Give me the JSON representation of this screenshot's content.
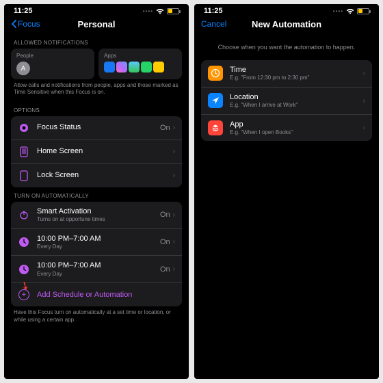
{
  "status": {
    "time": "11:25"
  },
  "left": {
    "back": "Focus",
    "title": "Personal",
    "allowed_header": "ALLOWED NOTIFICATIONS",
    "people_label": "People",
    "people_initial": "A",
    "apps_label": "Apps",
    "allowed_footer": "Allow calls and notifications from people, apps and those marked as Time Sensitive when this Focus is on.",
    "options_header": "OPTIONS",
    "options": [
      {
        "label": "Focus Status",
        "value": "On"
      },
      {
        "label": "Home Screen",
        "value": ""
      },
      {
        "label": "Lock Screen",
        "value": ""
      }
    ],
    "auto_header": "TURN ON AUTOMATICALLY",
    "auto": [
      {
        "label": "Smart Activation",
        "sub": "Turns on at opportune times",
        "value": "On"
      },
      {
        "label": "10:00 PM–7:00 AM",
        "sub": "Every Day",
        "value": "On"
      },
      {
        "label": "10:00 PM–7:00 AM",
        "sub": "Every Day",
        "value": "On"
      }
    ],
    "add_label": "Add Schedule or Automation",
    "auto_footer": "Have this Focus turn on automatically at a set time or location, or while using a certain app."
  },
  "right": {
    "cancel": "Cancel",
    "title": "New Automation",
    "prompt": "Choose when you want the automation to happen.",
    "triggers": [
      {
        "label": "Time",
        "sub": "E.g. \"From 12:30 pm to 2:30 pm\"",
        "color": "orange"
      },
      {
        "label": "Location",
        "sub": "E.g. \"When I arrive at Work\"",
        "color": "blue"
      },
      {
        "label": "App",
        "sub": "E.g. \"When I open Books\"",
        "color": "red"
      }
    ]
  }
}
